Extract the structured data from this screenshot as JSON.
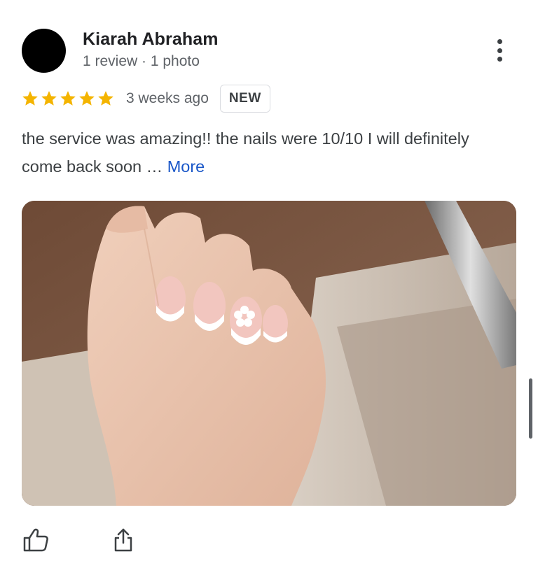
{
  "review": {
    "author_name": "Kiarah Abraham",
    "author_meta": "1 review · 1 photo",
    "rating": 5,
    "max_rating": 5,
    "date": "3 weeks ago",
    "badge": "NEW",
    "text": "the service was amazing!! the nails were 10/10 I will definitely come back soon … ",
    "more_label": "More"
  },
  "colors": {
    "star": "#F4B400",
    "link": "#1A57C8",
    "avatar": "#000000"
  },
  "icons": {
    "menu": "more-vert-icon",
    "like": "thumbs-up-icon",
    "share": "share-icon"
  }
}
